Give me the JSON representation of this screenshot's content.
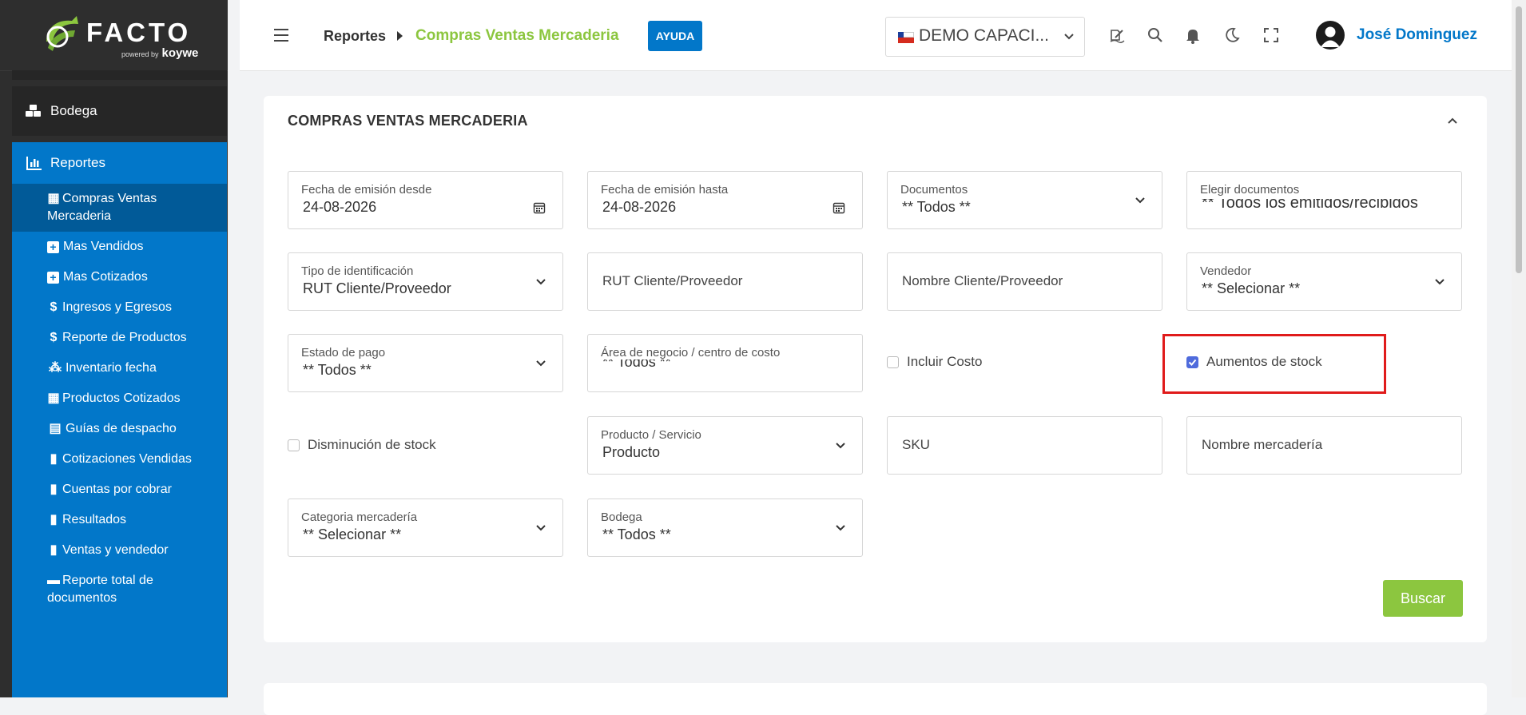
{
  "brand": {
    "name": "FACTO",
    "powered": "powered by",
    "partner": "koywe",
    "accent": "#8cc63f",
    "primary": "#0277c9"
  },
  "sidebar": {
    "bodega": {
      "label": "Bodega",
      "icon": "cubes-icon"
    },
    "reportes": {
      "label": "Reportes",
      "icon": "bar-chart-icon"
    },
    "items": [
      {
        "label": "Compras Ventas Mercaderia",
        "icon": "calculator-icon"
      },
      {
        "label": "Mas Vendidos",
        "icon": "plus-square-icon"
      },
      {
        "label": "Mas Cotizados",
        "icon": "plus-square-icon"
      },
      {
        "label": "Ingresos y Egresos",
        "icon": "dollar-icon"
      },
      {
        "label": "Reporte de Productos",
        "icon": "dollar-icon"
      },
      {
        "label": "Inventario fecha",
        "icon": "cubes-icon"
      },
      {
        "label": "Productos Cotizados",
        "icon": "calculator-icon"
      },
      {
        "label": "Guías de despacho",
        "icon": "table-icon"
      },
      {
        "label": "Cotizaciones Vendidas",
        "icon": "file-icon"
      },
      {
        "label": "Cuentas por cobrar",
        "icon": "file-icon"
      },
      {
        "label": "Resultados",
        "icon": "file-icon"
      },
      {
        "label": "Ventas y vendedor",
        "icon": "file-icon"
      },
      {
        "label": "Reporte total de documentos",
        "icon": "archive-icon"
      }
    ]
  },
  "header": {
    "breadcrumb": {
      "parent": "Reportes",
      "current": "Compras Ventas Mercaderia"
    },
    "help_label": "AYUDA",
    "company": "DEMO CAPACI...",
    "user_name": "José Dominguez"
  },
  "form": {
    "title": "COMPRAS VENTAS MERCADERIA",
    "fecha_desde": {
      "label": "Fecha de emisión desde",
      "value": "24-08-2026"
    },
    "fecha_hasta": {
      "label": "Fecha de emisión hasta",
      "value": "24-08-2026"
    },
    "documentos": {
      "label": "Documentos",
      "value": "** Todos **"
    },
    "elegir_documentos": {
      "label": "Elegir documentos",
      "value": "** Todos los emitidos/recibidos"
    },
    "tipo_identificacion": {
      "label": "Tipo de identificación",
      "value": "RUT Cliente/Proveedor"
    },
    "rut_placeholder": "RUT Cliente/Proveedor",
    "nombre_placeholder": "Nombre Cliente/Proveedor",
    "vendedor": {
      "label": "Vendedor",
      "value": "** Selecionar **"
    },
    "estado_pago": {
      "label": "Estado de pago",
      "value": "** Todos **"
    },
    "area_negocio": {
      "label": "Área de negocio / centro de costo",
      "value": "** Todos **"
    },
    "incluir_costo": {
      "label": "Incluir Costo",
      "checked": false
    },
    "aumentos_stock": {
      "label": "Aumentos de stock",
      "checked": true
    },
    "disminucion_stock": {
      "label": "Disminución de stock",
      "checked": false
    },
    "producto_servicio": {
      "label": "Producto / Servicio",
      "value": "Producto"
    },
    "sku_placeholder": "SKU",
    "nombre_mercaderia_placeholder": "Nombre mercadería",
    "categoria": {
      "label": "Categoria mercadería",
      "value": "** Selecionar **"
    },
    "bodega": {
      "label": "Bodega",
      "value": "** Todos **"
    },
    "search_label": "Buscar"
  }
}
